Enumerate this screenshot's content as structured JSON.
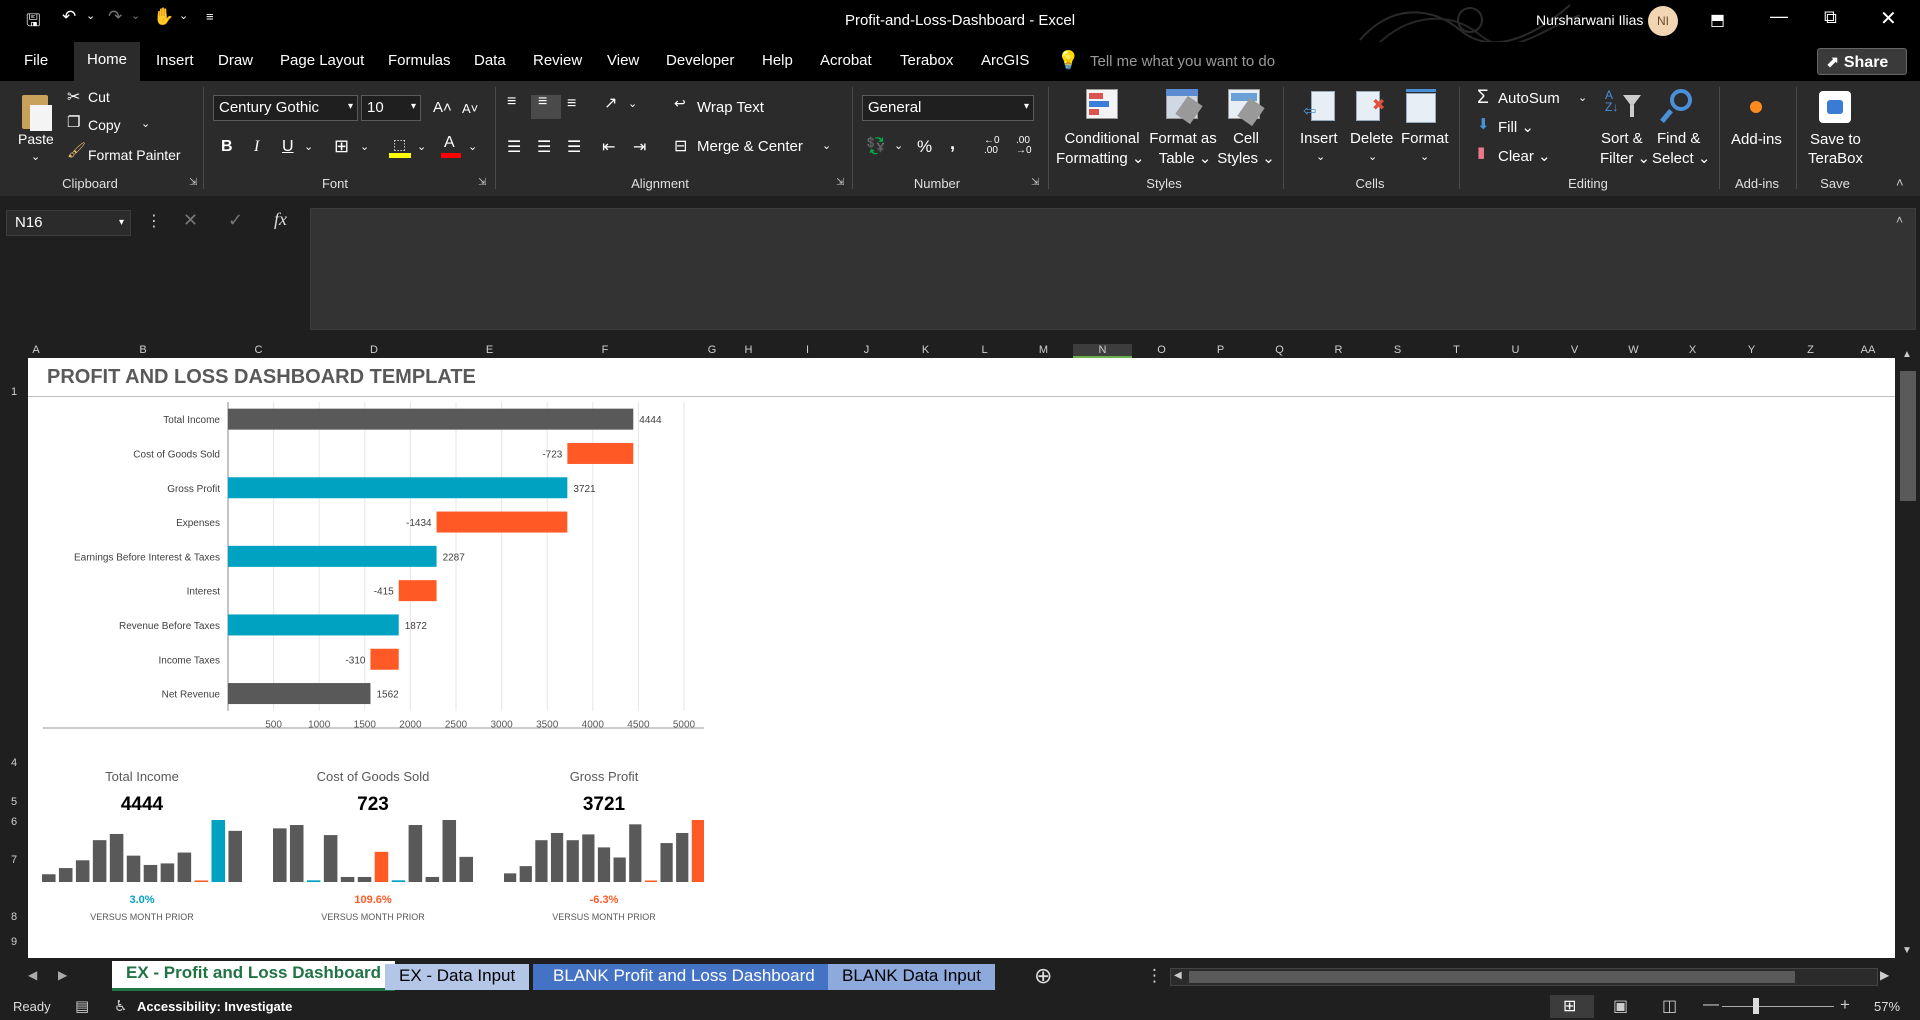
{
  "window": {
    "title": "Profit-and-Loss-Dashboard  -  Excel",
    "user_name": "Nursharwani Ilias",
    "user_initials": "NI"
  },
  "menu": {
    "tabs": [
      "File",
      "Home",
      "Insert",
      "Draw",
      "Page Layout",
      "Formulas",
      "Data",
      "Review",
      "View",
      "Developer",
      "Help",
      "Acrobat",
      "Terabox",
      "ArcGIS"
    ],
    "active": "Home",
    "tell_me": "Tell me what you want to do",
    "share": "Share"
  },
  "ribbon": {
    "clipboard": {
      "paste": "Paste",
      "cut": "Cut",
      "copy": "Copy",
      "format_painter": "Format Painter",
      "label": "Clipboard"
    },
    "font": {
      "name": "Century Gothic",
      "size": "10",
      "label": "Font",
      "bold": "B",
      "italic": "I",
      "underline": "U"
    },
    "alignment": {
      "wrap": "Wrap Text",
      "merge": "Merge & Center",
      "label": "Alignment"
    },
    "number": {
      "format": "General",
      "label": "Number",
      "percent": "%",
      "comma": ","
    },
    "styles": {
      "conditional_1": "Conditional",
      "conditional_2": "Formatting",
      "format_table_1": "Format as",
      "format_table_2": "Table",
      "cell_styles_1": "Cell",
      "cell_styles_2": "Styles",
      "label": "Styles"
    },
    "cells": {
      "insert": "Insert",
      "delete": "Delete",
      "format": "Format",
      "label": "Cells"
    },
    "editing": {
      "autosum": "AutoSum",
      "fill": "Fill",
      "clear": "Clear",
      "sort_1": "Sort &",
      "sort_2": "Filter",
      "find_1": "Find &",
      "find_2": "Select",
      "label": "Editing"
    },
    "addins": {
      "button": "Add-ins",
      "label": "Add-ins"
    },
    "save": {
      "button_1": "Save to",
      "button_2": "TeraBox",
      "label": "Save"
    }
  },
  "formula_bar": {
    "name_box": "N16",
    "fx": "fx",
    "content": ""
  },
  "columns": [
    "A",
    "B",
    "C",
    "D",
    "E",
    "F",
    "G",
    "H",
    "I",
    "J",
    "K",
    "L",
    "M",
    "N",
    "O",
    "P",
    "Q",
    "R",
    "S",
    "T",
    "U",
    "V",
    "W",
    "X",
    "Y",
    "Z",
    "AA"
  ],
  "rows": [
    "1",
    "4",
    "5",
    "6",
    "7",
    "8",
    "9"
  ],
  "sheet": {
    "title": "PROFIT AND LOSS DASHBOARD TEMPLATE"
  },
  "chart_data": [
    {
      "type": "bar",
      "subtype": "waterfall",
      "categories": [
        "Total Income",
        "Cost of Goods Sold",
        "Gross Profit",
        "Expenses",
        "Earnings Before Interest & Taxes",
        "Interest",
        "Revenue Before Taxes",
        "Income Taxes",
        "Net Revenue"
      ],
      "values": [
        4444,
        -723,
        3721,
        -1434,
        2287,
        -415,
        1872,
        -310,
        1562
      ],
      "bar_start": [
        0,
        3721,
        0,
        2287,
        0,
        1872,
        0,
        1562,
        0
      ],
      "bar_end": [
        4444,
        4444,
        3721,
        3721,
        2287,
        2287,
        1872,
        1872,
        1562
      ],
      "bar_kind": [
        "total",
        "negative",
        "subtotal",
        "negative",
        "subtotal",
        "negative",
        "subtotal",
        "negative",
        "total"
      ],
      "xticks": [
        500,
        1000,
        1500,
        2000,
        2500,
        3000,
        3500,
        4000,
        4500,
        5000
      ],
      "xlim": [
        0,
        5000
      ],
      "colors": {
        "total": "#595959",
        "negative": "#ff5a26",
        "subtotal": "#00a2c2"
      },
      "grid": true
    },
    {
      "type": "bar",
      "title": "Total Income",
      "kpi": "4444",
      "change": "3.0%",
      "change_color": "#00a2c2",
      "footer": "VERSUS MONTH PRIOR",
      "values": [
        5,
        9,
        14,
        27,
        31,
        17,
        11,
        12,
        19,
        1,
        40,
        33
      ],
      "highlight": [
        10
      ]
    },
    {
      "type": "bar",
      "title": "Cost of Goods Sold",
      "kpi": "723",
      "change": "109.6%",
      "change_color": "#ff5a26",
      "footer": "VERSUS MONTH PRIOR",
      "values": [
        32,
        34,
        1,
        28,
        3,
        3,
        18,
        1,
        34,
        3,
        37,
        15
      ],
      "highlight": [
        6
      ]
    },
    {
      "type": "bar",
      "title": "Gross Profit",
      "kpi": "3721",
      "change": "-6.3%",
      "change_color": "#ff5a26",
      "footer": "VERSUS MONTH PRIOR",
      "values": [
        6,
        11,
        29,
        34,
        29,
        33,
        24,
        17,
        40,
        1,
        27,
        34,
        43
      ],
      "highlight": [
        12
      ]
    }
  ],
  "tabs": {
    "items": [
      "EX - Profit and Loss Dashboard",
      "EX - Data Input",
      "BLANK Profit and Loss Dashboard",
      "BLANK Data Input"
    ],
    "active": "EX - Profit and Loss Dashboard"
  },
  "status": {
    "ready": "Ready",
    "accessibility": "Accessibility: Investigate",
    "zoom": "57%"
  }
}
